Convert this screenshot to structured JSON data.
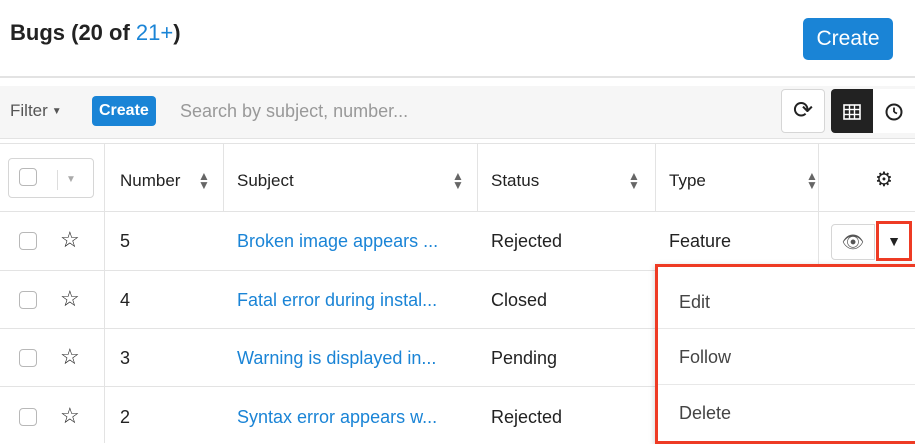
{
  "header": {
    "title_prefix": "Bugs (20 of ",
    "title_count": "21+",
    "title_suffix": ")",
    "create_label": "Create"
  },
  "filterbar": {
    "filter_label": "Filter",
    "create_label": "Create",
    "search_placeholder": "Search by subject, number...",
    "active_view": "list"
  },
  "table": {
    "columns": [
      "Number",
      "Subject",
      "Status",
      "Type"
    ],
    "rows": [
      {
        "number": "5",
        "subject": "Broken image appears ...",
        "status": "Rejected",
        "type": "Feature"
      },
      {
        "number": "4",
        "subject": "Fatal error during instal...",
        "status": "Closed",
        "type": ""
      },
      {
        "number": "3",
        "subject": "Warning is displayed in...",
        "status": "Pending",
        "type": ""
      },
      {
        "number": "2",
        "subject": "Syntax error appears w...",
        "status": "Rejected",
        "type": ""
      }
    ]
  },
  "row_actions_menu": {
    "items": [
      "Edit",
      "Follow",
      "Delete"
    ]
  },
  "colors": {
    "accent": "#1a84d6",
    "highlight": "#ee3b24"
  },
  "icons": {
    "refresh": "refresh-icon",
    "grid": "grid-view-icon",
    "clock": "clock-icon",
    "gear": "gear-icon",
    "eye": "eye-icon",
    "caret": "caret-down-icon",
    "star": "star-outline-icon"
  }
}
